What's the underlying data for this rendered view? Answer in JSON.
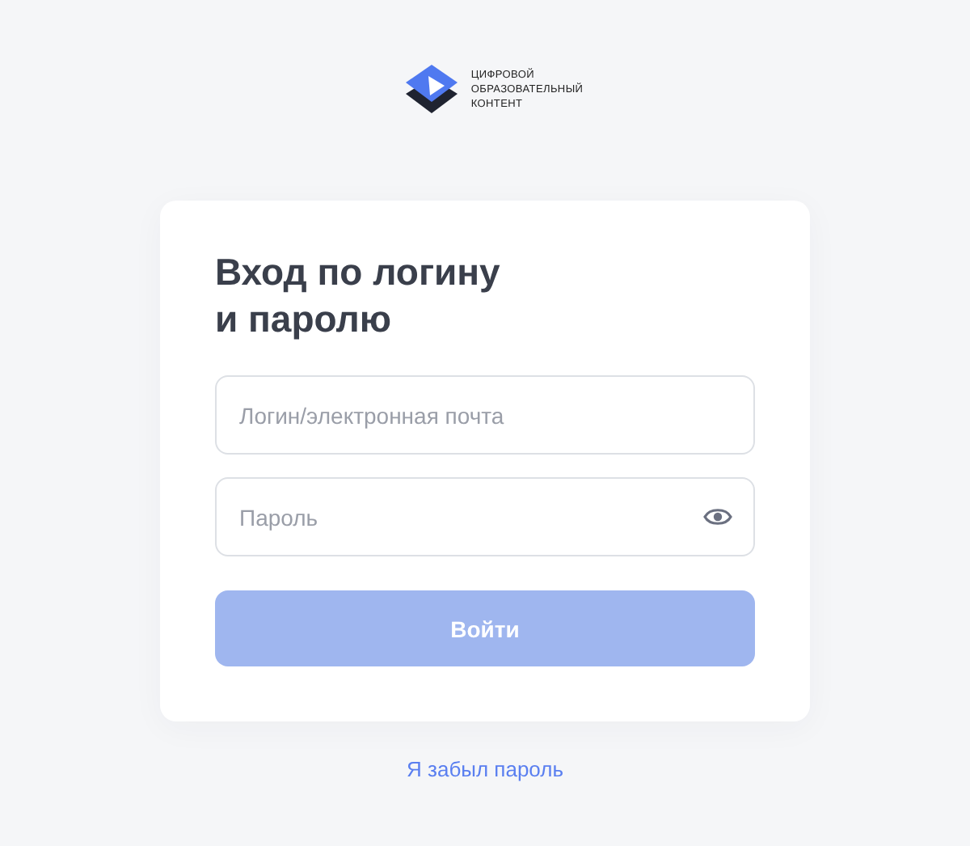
{
  "logo": {
    "lines": [
      "ЦИФРОВОЙ",
      "ОБРАЗОВАТЕЛЬНЫЙ",
      "КОНТЕНТ"
    ]
  },
  "form": {
    "title": "Вход по логину и паролю",
    "fields": [
      {
        "kind": "text",
        "placeholder": "Логин/электронная почта"
      },
      {
        "kind": "password",
        "placeholder": "Пароль"
      }
    ],
    "submit": {
      "label": "Войти",
      "disabled": true
    }
  },
  "forgot_link": "Я забыл пароль"
}
